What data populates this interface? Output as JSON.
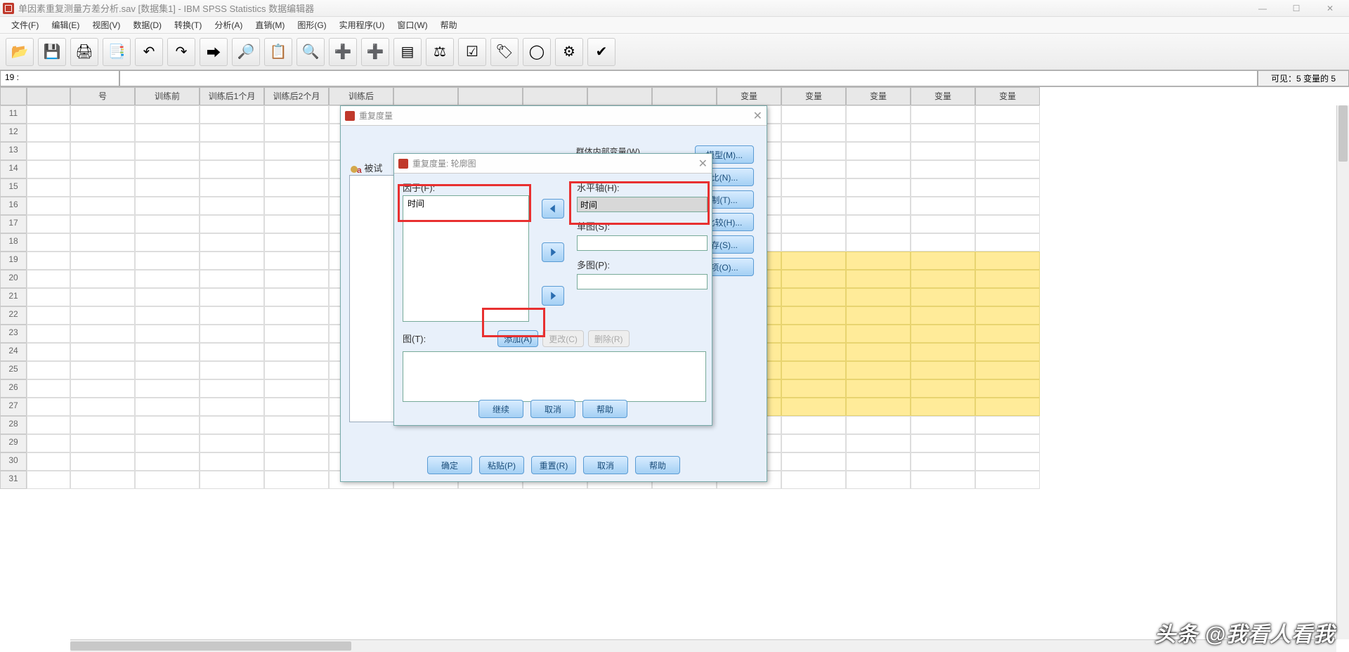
{
  "window": {
    "title": "单因素重复测量方差分析.sav [数据集1] - IBM SPSS Statistics 数据编辑器"
  },
  "menu": [
    "文件(F)",
    "编辑(E)",
    "视图(V)",
    "数据(D)",
    "转换(T)",
    "分析(A)",
    "直销(M)",
    "图形(G)",
    "实用程序(U)",
    "窗口(W)",
    "帮助"
  ],
  "toolbar_icons": [
    "open",
    "save",
    "print",
    "recent",
    "undo",
    "redo",
    "goto",
    "find-var",
    "variables",
    "find",
    "insert-case",
    "insert-var",
    "split",
    "weight",
    "select",
    "value-labels",
    "sets",
    "customize",
    "spellcheck"
  ],
  "cellref": {
    "label": "19 :",
    "value": ""
  },
  "visible_info": "可见：5 变量的 5",
  "columns": [
    "",
    "号",
    "训练前",
    "训练后1个月",
    "训练后2个月",
    "训练后",
    "",
    "",
    "",
    "",
    "",
    "变量",
    "变量",
    "变量",
    "变量",
    "变量"
  ],
  "row_start": 11,
  "row_end": 31,
  "highlight_rows_from": 19,
  "highlight_cols_from": 11,
  "dialog1": {
    "title": "重复度量",
    "subjects_label": "被试",
    "within_label": "群体内部变量(W)",
    "side_buttons": [
      "模型(M)...",
      "比(N)...",
      "制(T)...",
      "比较(H)...",
      "存(S)...",
      "项(O)..."
    ],
    "buttons": [
      "确定",
      "粘贴(P)",
      "重置(R)",
      "取消",
      "帮助"
    ]
  },
  "dialog2": {
    "title": "重复度量: 轮廓图",
    "factor_label": "因子(F):",
    "factor_value": "时间",
    "haxis_label": "水平轴(H):",
    "haxis_value": "时间",
    "sep_label": "单图(S):",
    "sep_value": "",
    "multi_label": "多图(P):",
    "multi_value": "",
    "plots_label": "图(T):",
    "add": "添加(A)",
    "change": "更改(C)",
    "remove": "删除(R)",
    "buttons": [
      "继续",
      "取消",
      "帮助"
    ]
  },
  "watermark": "头条 @我看人看我"
}
